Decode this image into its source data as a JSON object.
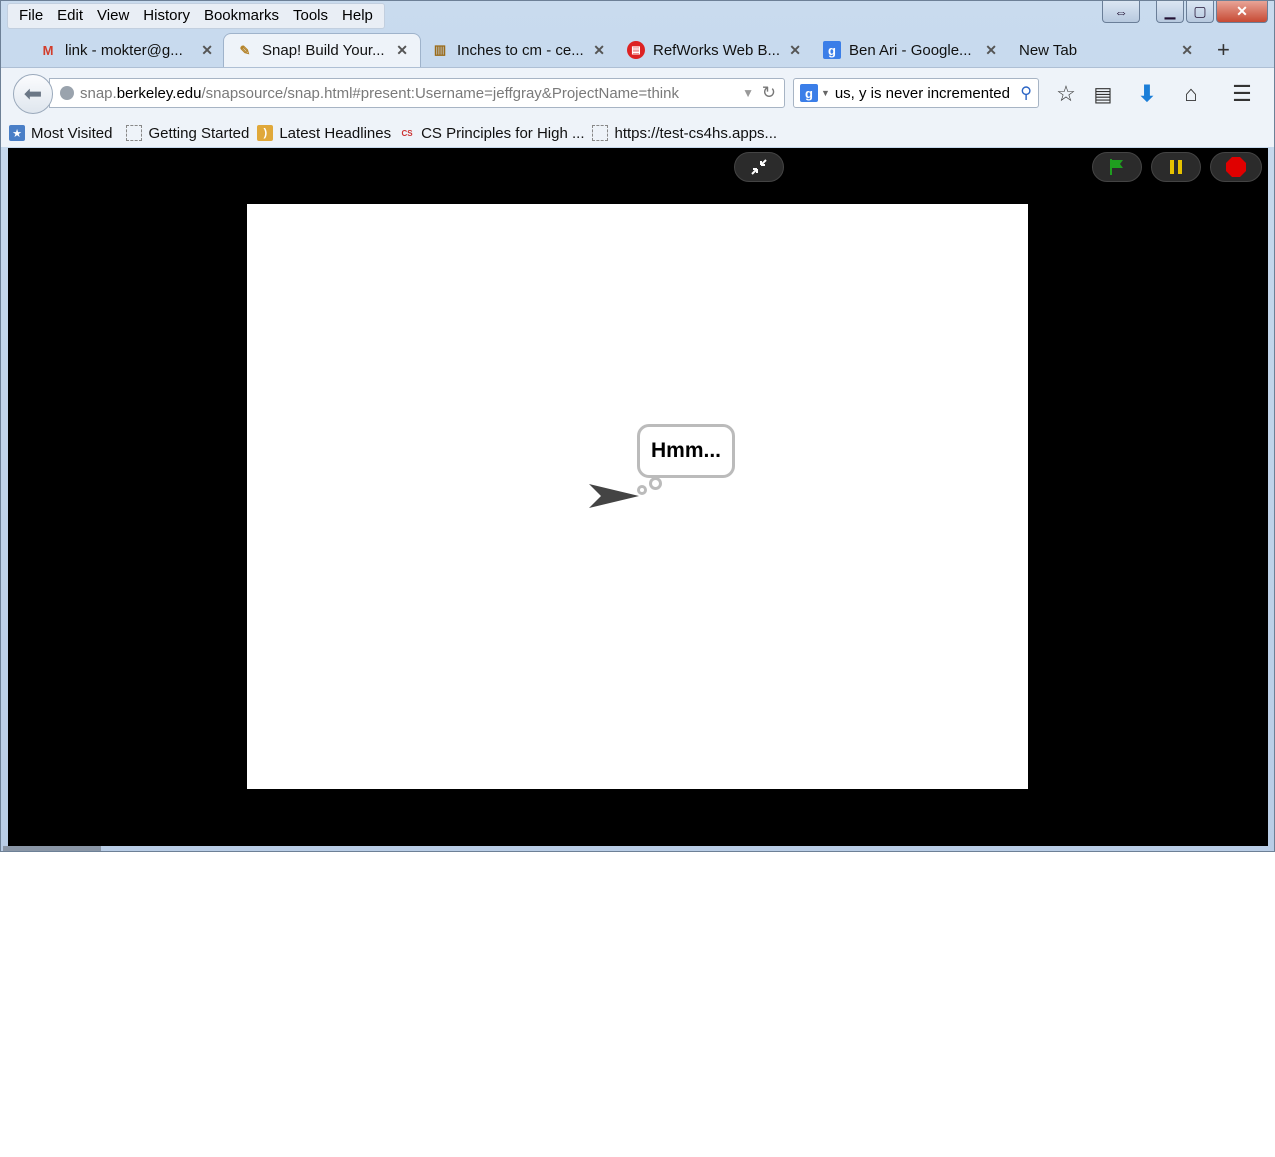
{
  "menu": [
    "File",
    "Edit",
    "View",
    "History",
    "Bookmarks",
    "Tools",
    "Help"
  ],
  "tabs": [
    {
      "label": "link - mokter@g...",
      "icon": "gmail-icon"
    },
    {
      "label": "Snap! Build Your...",
      "icon": "snap-icon"
    },
    {
      "label": "Inches to cm - ce...",
      "icon": "ruler-icon"
    },
    {
      "label": "RefWorks Web B...",
      "icon": "refworks-icon"
    },
    {
      "label": "Ben Ari - Google...",
      "icon": "google-icon"
    },
    {
      "label": "New Tab",
      "icon": ""
    }
  ],
  "url": {
    "prefix": "snap.",
    "domain": "berkeley.edu",
    "path": "/snapsource/snap.html#present:Username=jeffgray&ProjectName=think"
  },
  "search": {
    "value": "nus, y is never incremented"
  },
  "bookmarks": [
    {
      "label": "Most Visited",
      "icon": "most-visited-icon"
    },
    {
      "label": "Getting Started",
      "icon": "page-icon"
    },
    {
      "label": "Latest Headlines",
      "icon": "rss-icon"
    },
    {
      "label": "CS Principles for High ...",
      "icon": "cs4hs-icon"
    },
    {
      "label": "https://test-cs4hs.apps...",
      "icon": "page-icon"
    }
  ],
  "stage": {
    "bubble_text": "Hmm..."
  },
  "colors": {
    "flag": "#1f9e1f",
    "pause": "#e6c200",
    "stop": "#e00000",
    "stage_bg": "#ffffff",
    "presentation_bg": "#000000"
  }
}
